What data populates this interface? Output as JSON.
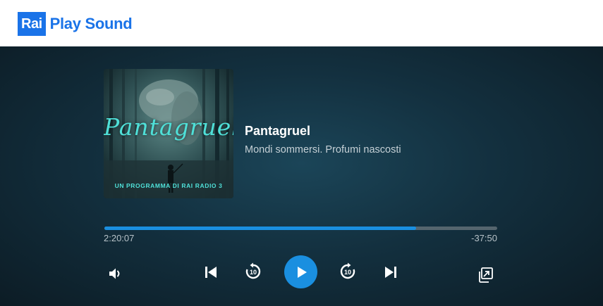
{
  "header": {
    "logo_box": "Rai",
    "logo_text": "Play Sound",
    "brand_color": "#1a73e8"
  },
  "cover": {
    "title": "Pantagruel",
    "subtitle": "UN PROGRAMMA DI RAI RADIO 3"
  },
  "track": {
    "title": "Pantagruel",
    "subtitle": "Mondi sommersi. Profumi nascosti"
  },
  "progress": {
    "fraction": 0.794,
    "elapsed": "2:20:07",
    "remaining": "-37:50",
    "fill_color": "#1a8fe0"
  },
  "controls": {
    "volume_icon": "speaker-icon",
    "prev_icon": "skip-previous-icon",
    "rewind_icon": "rewind-10-icon",
    "rewind_label": "10",
    "play_icon": "play-icon",
    "forward_icon": "forward-10-icon",
    "forward_label": "10",
    "next_icon": "skip-next-icon",
    "popout_icon": "popout-icon"
  }
}
